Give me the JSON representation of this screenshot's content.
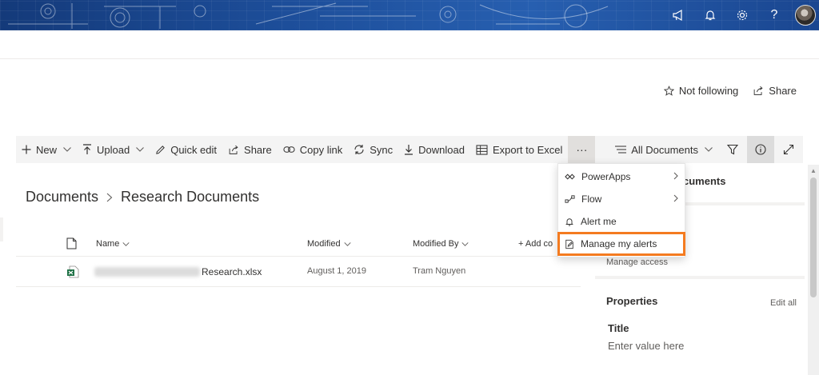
{
  "suitebar": {
    "icons": [
      "megaphone-icon",
      "bell-icon",
      "gear-icon",
      "help-icon",
      "avatar"
    ],
    "help_glyph": "?"
  },
  "header": {
    "not_following": "Not following",
    "share": "Share"
  },
  "commandbar": {
    "items": {
      "new": "New",
      "upload": "Upload",
      "quick_edit": "Quick edit",
      "share": "Share",
      "copy_link": "Copy link",
      "sync": "Sync",
      "download": "Download",
      "export": "Export to Excel"
    },
    "more": "···",
    "view": "All Documents"
  },
  "breadcrumb": {
    "root": "Documents",
    "current": "Research Documents"
  },
  "list": {
    "columns": {
      "name": "Name",
      "modified": "Modified",
      "modified_by": "Modified By",
      "add_column": "+ Add co"
    },
    "rows": [
      {
        "name": "Research.xlsx",
        "modified": "August 1, 2019",
        "modified_by": "Tram Nguyen"
      }
    ]
  },
  "menu": {
    "items": [
      {
        "label": "PowerApps",
        "icon": "powerapps-icon",
        "submenu": true
      },
      {
        "label": "Flow",
        "icon": "flow-icon",
        "submenu": true
      },
      {
        "label": "Alert me",
        "icon": "bell-icon",
        "submenu": false
      },
      {
        "label": "Manage my alerts",
        "icon": "edit-alerts-icon",
        "submenu": false
      }
    ],
    "highlight_color": "#f47b20"
  },
  "pane": {
    "title": "cuments",
    "manage_access": "Manage access",
    "properties": "Properties",
    "edit_all": "Edit all",
    "field_title": "Title",
    "field_placeholder": "Enter value here"
  },
  "colors": {
    "suitebar": "#1d4e9a",
    "commandbar": "#f4f4f4",
    "excel_green": "#1e7145",
    "highlight": "#f47b20"
  }
}
